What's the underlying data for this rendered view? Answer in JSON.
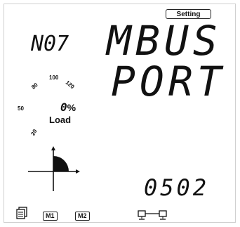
{
  "header": {
    "setting_badge": "Setting"
  },
  "display": {
    "item_no": "N07",
    "line1": "MBUS",
    "line2": "PORT",
    "value": "0502"
  },
  "load_gauge": {
    "ticks": [
      "20",
      "50",
      "80",
      "100",
      "120"
    ],
    "percent_value": "0",
    "percent_unit": "%",
    "label": "Load"
  },
  "quadrant": {
    "active_quadrant": "I"
  },
  "footer": {
    "m1": "M1",
    "m2": "M2",
    "icons": [
      "meter-icon",
      "network-icon"
    ]
  }
}
